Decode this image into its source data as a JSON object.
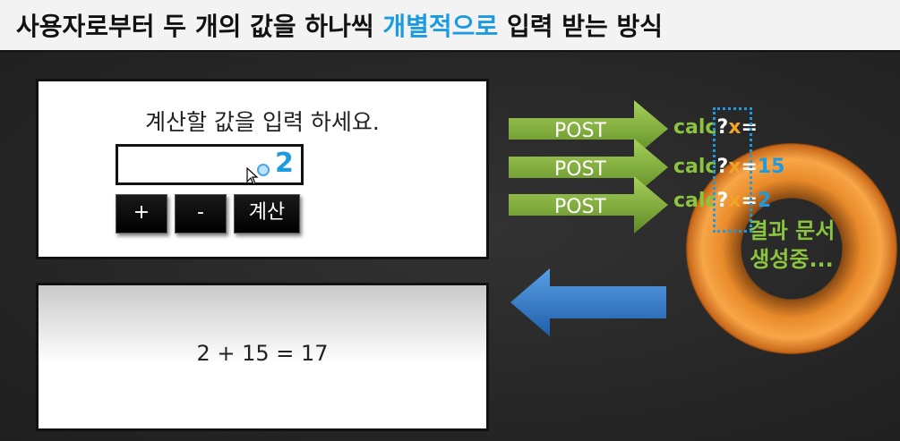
{
  "title": {
    "part1": "사용자로부터 두 개의 값을 하나씩 ",
    "highlight": "개별적으로",
    "part2": " 입력 받는 방식"
  },
  "input_panel": {
    "prompt": "계산할 값을 입력 하세요.",
    "typed_value": "2",
    "buttons": {
      "plus": "+",
      "minus": "-",
      "calc": "계산"
    }
  },
  "result_panel": {
    "text": "2 + 15 = 17"
  },
  "requests": [
    {
      "method": "POST",
      "key": "calc",
      "q": "?",
      "param": "x",
      "eq": "=",
      "value": ""
    },
    {
      "method": "POST",
      "key": "calc",
      "q": "?",
      "param": "x",
      "eq": "=",
      "value": "15"
    },
    {
      "method": "POST",
      "key": "calc",
      "q": "?",
      "param": "x",
      "eq": "=",
      "value": "2"
    }
  ],
  "server": {
    "line1": "결과 문서",
    "line2": "생성중..."
  },
  "colors": {
    "accent_blue": "#1e9be0",
    "post_green": "#8bc540",
    "param_orange": "#f2a32a",
    "donut_orange": "#f7a648",
    "return_arrow_blue": "#2e78c8"
  }
}
